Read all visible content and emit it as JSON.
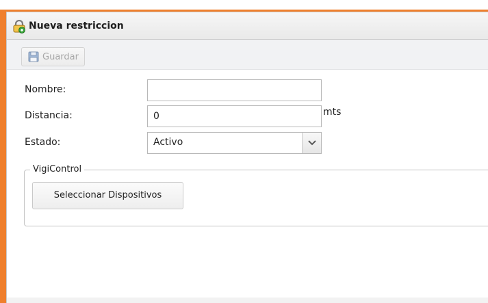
{
  "window": {
    "title": "Nueva restriccion",
    "accent_color": "#ef7f2d"
  },
  "toolbar": {
    "save_label": "Guardar",
    "save_icon": "save-icon"
  },
  "form": {
    "nombre": {
      "label": "Nombre:",
      "value": ""
    },
    "distancia": {
      "label": "Distancia:",
      "value": "0",
      "unit": "mts"
    },
    "estado": {
      "label": "Estado:",
      "value": "Activo"
    },
    "vigicontrol": {
      "legend": "VigiControl",
      "button_label": "Seleccionar Dispositivos"
    }
  }
}
